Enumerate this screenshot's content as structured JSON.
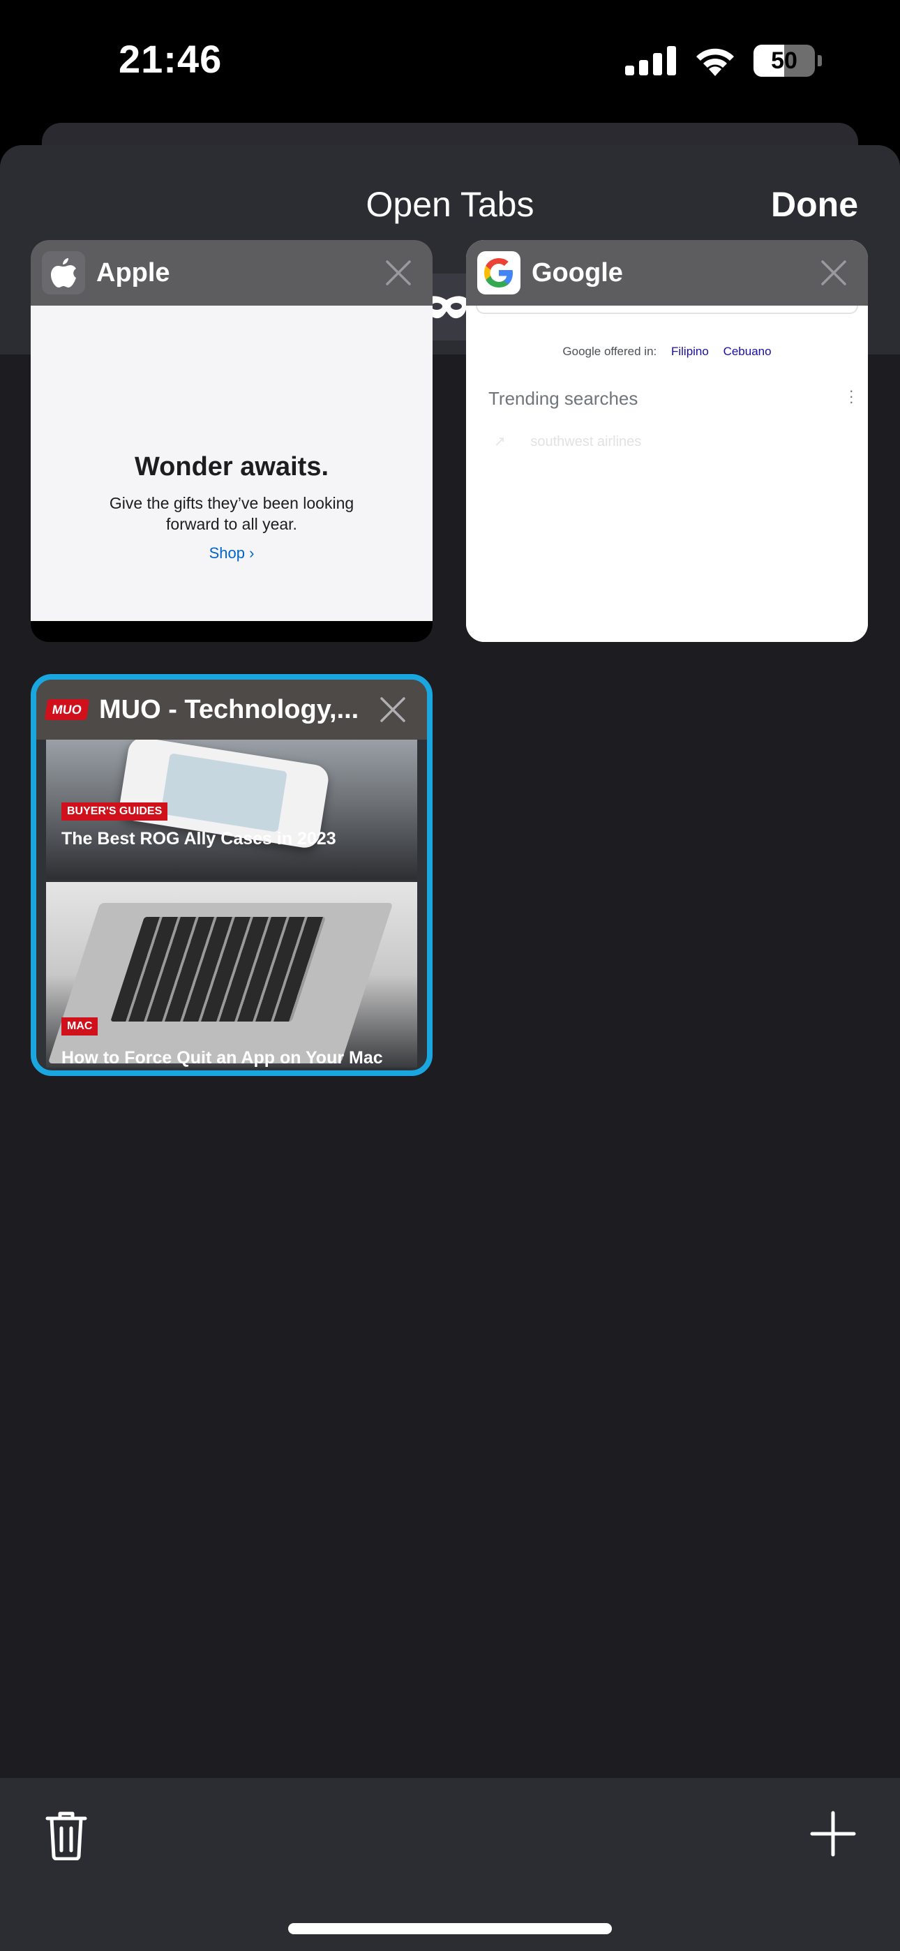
{
  "status_bar": {
    "time": "21:46",
    "battery_level": 50,
    "battery_text": "50"
  },
  "header": {
    "title": "Open Tabs",
    "done_label": "Done"
  },
  "segments": {
    "tab_count": "3",
    "active": "regular-tabs",
    "icons": [
      "tab-count-icon",
      "incognito-mask-icon",
      "devices-icon"
    ]
  },
  "tabs": [
    {
      "title": "Apple",
      "favicon": "apple-logo-icon",
      "preview": {
        "headline": "Wonder awaits.",
        "subline": "Give the gifts they’ve been looking forward to all year.",
        "link": "Shop ›"
      }
    },
    {
      "title": "Google",
      "favicon": "google-logo-icon",
      "preview": {
        "offered_in": "Google offered in:",
        "languages": [
          "Filipino",
          "Cebuano"
        ],
        "trending": "Trending searches",
        "trending_item": "southwest airlines"
      }
    },
    {
      "title": "MUO - Technology,...",
      "favicon": "muo-logo-icon",
      "favicon_text": "MUO",
      "selected": true,
      "preview": {
        "tag_1": "BUYER'S GUIDES",
        "headline_1": "The Best ROG Ally Cases in 2023",
        "tag_2": "MAC",
        "headline_2": "How to Force Quit an App on Your Mac"
      }
    }
  ],
  "toolbar": {
    "left_icon": "trash-icon",
    "right_icon": "plus-icon"
  },
  "colors": {
    "selected_border": "#1aa7e0",
    "muo_red": "#d0111b",
    "sheet_bg": "#1c1c21",
    "header_bg": "#2c2c33"
  }
}
